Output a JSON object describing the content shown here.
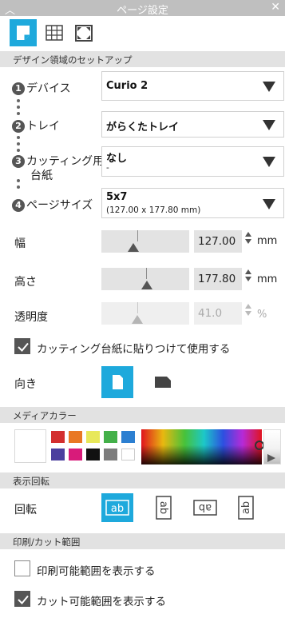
{
  "window": {
    "title": "ページ設定",
    "collapse_icon": "chevron-up-icon",
    "close_icon": "close-icon"
  },
  "tabs": [
    {
      "name": "page-setup-icon",
      "active": true
    },
    {
      "name": "grid-icon",
      "active": false
    },
    {
      "name": "fullscreen-icon",
      "active": false
    }
  ],
  "design_setup": {
    "header": "デザイン領域のセットアップ",
    "steps": [
      {
        "num": "1",
        "label": "デバイス",
        "value": "Curio 2",
        "sub": ""
      },
      {
        "num": "2",
        "label": "トレイ",
        "value": "がらくたトレイ",
        "sub": ""
      },
      {
        "num": "3",
        "label": "カッティング用",
        "label2": "台紙",
        "value": "なし",
        "sub": "-"
      },
      {
        "num": "4",
        "label": "ページサイズ",
        "value": "5x7",
        "sub": "(127.00 x 177.80 mm)"
      }
    ]
  },
  "dimensions": {
    "width": {
      "label": "幅",
      "value": "127.00",
      "unit": "mm",
      "level": 0.35
    },
    "height": {
      "label": "高さ",
      "value": "177.80",
      "unit": "mm",
      "level": 0.5
    },
    "opacity": {
      "label": "透明度",
      "value": "41.0",
      "unit": "%",
      "level": 0.41
    }
  },
  "mat_checkbox": {
    "label": "カッティング台紙に貼りつけて使用する",
    "checked": true
  },
  "orientation": {
    "label": "向き",
    "selected": "portrait"
  },
  "media_color": {
    "header": "メディアカラー",
    "swatches": [
      "#d32f2f",
      "#e97824",
      "#e8e85a",
      "#43b049",
      "#2c7fd1",
      "#4b3f9e",
      "#d81b7a",
      "#111111",
      "#7d7d7d",
      "#ffffff"
    ]
  },
  "rotation": {
    "header": "表示回転",
    "label": "回転",
    "selected_index": 0,
    "icon_text": "ab"
  },
  "print_cut": {
    "header": "印刷/カット範囲",
    "show_print": {
      "label": "印刷可能範囲を表示する",
      "checked": false
    },
    "show_cut": {
      "label": "カット可能範囲を表示する",
      "checked": true
    }
  }
}
